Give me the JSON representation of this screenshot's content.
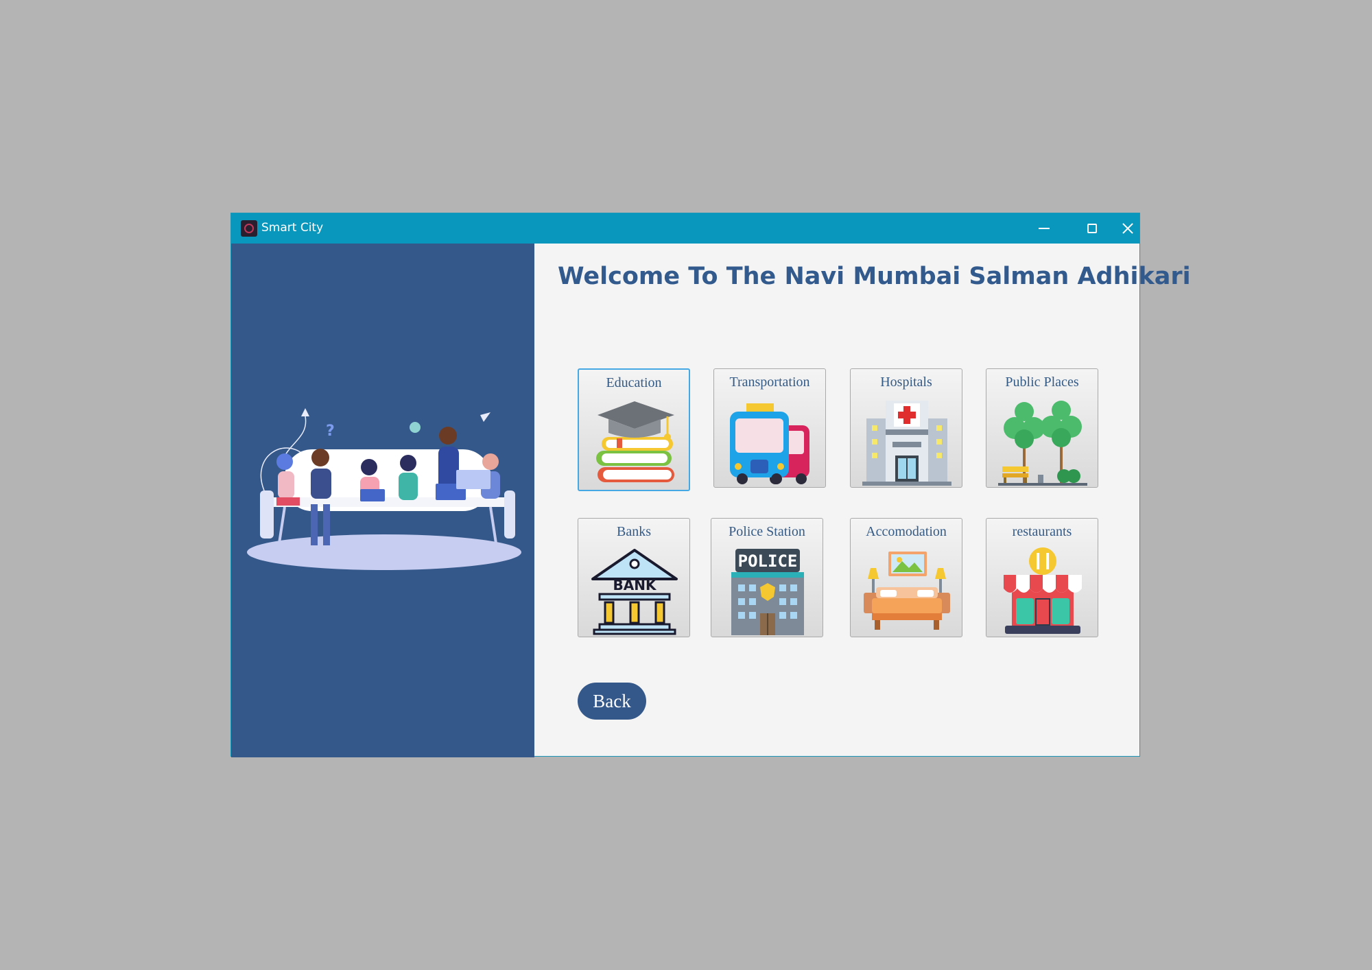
{
  "window": {
    "title": "Smart City"
  },
  "main": {
    "heading": "Welcome To The Navi Mumbai Salman Adhikari",
    "tiles": [
      {
        "label": "Education",
        "icon": "graduation-cap-books-icon",
        "selected": true
      },
      {
        "label": "Transportation",
        "icon": "bus-icon"
      },
      {
        "label": "Hospitals",
        "icon": "hospital-building-icon"
      },
      {
        "label": "Public Places",
        "icon": "park-trees-icon"
      },
      {
        "label": "Banks",
        "icon": "bank-building-icon"
      },
      {
        "label": "Police Station",
        "icon": "police-station-icon"
      },
      {
        "label": "Accomodation",
        "icon": "hotel-bed-icon"
      },
      {
        "label": "restaurants",
        "icon": "restaurant-store-icon"
      }
    ],
    "back_label": "Back"
  },
  "icons": {
    "bank_sign": "BANK",
    "police_sign": "POLICE"
  },
  "colors": {
    "titlebar": "#0a97bd",
    "sidebar": "#35588a",
    "heading": "#335a8d",
    "selected_border": "#44a8e4"
  }
}
